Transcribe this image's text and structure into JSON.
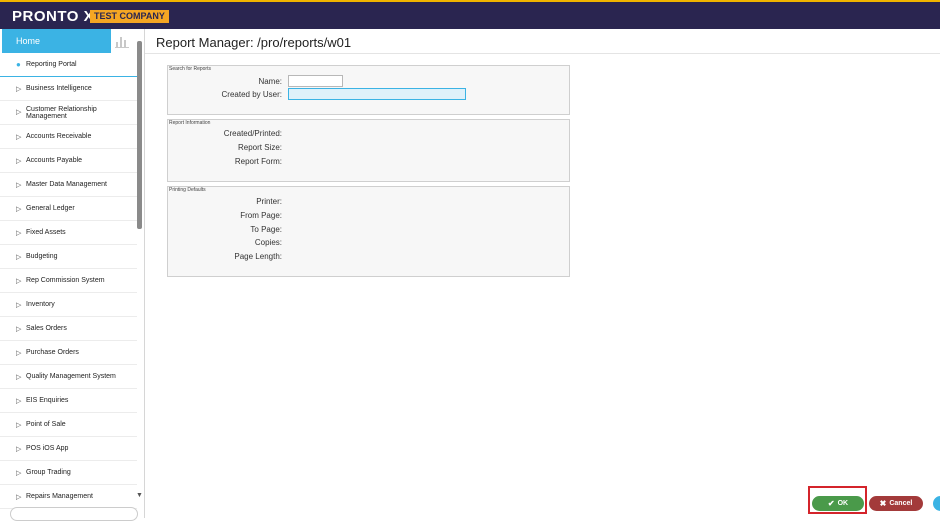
{
  "app": {
    "brand": "PRONTO Xi",
    "company_badge": "TEST COMPANY"
  },
  "sidebar": {
    "home_label": "Home",
    "home_icon": "bar-chart-icon",
    "items": [
      {
        "label": "Reporting Portal",
        "icon": "dot-icon",
        "active": true
      },
      {
        "label": "Business Intelligence",
        "icon": "triangle-right-icon"
      },
      {
        "label": "Customer Relationship Management",
        "icon": "triangle-right-icon"
      },
      {
        "label": "Accounts Receivable",
        "icon": "triangle-right-icon"
      },
      {
        "label": "Accounts Payable",
        "icon": "triangle-right-icon"
      },
      {
        "label": "Master Data Management",
        "icon": "triangle-right-icon"
      },
      {
        "label": "General Ledger",
        "icon": "triangle-right-icon"
      },
      {
        "label": "Fixed Assets",
        "icon": "triangle-right-icon"
      },
      {
        "label": "Budgeting",
        "icon": "triangle-right-icon"
      },
      {
        "label": "Rep Commission System",
        "icon": "triangle-right-icon"
      },
      {
        "label": "Inventory",
        "icon": "triangle-right-icon"
      },
      {
        "label": "Sales Orders",
        "icon": "triangle-right-icon"
      },
      {
        "label": "Purchase Orders",
        "icon": "triangle-right-icon"
      },
      {
        "label": "Quality Management System",
        "icon": "triangle-right-icon"
      },
      {
        "label": "EIS Enquiries",
        "icon": "triangle-right-icon"
      },
      {
        "label": "Point of Sale",
        "icon": "triangle-right-icon"
      },
      {
        "label": "POS iOS App",
        "icon": "triangle-right-icon"
      },
      {
        "label": "Group Trading",
        "icon": "triangle-right-icon"
      },
      {
        "label": "Repairs Management",
        "icon": "triangle-right-icon"
      }
    ]
  },
  "main": {
    "title": "Report Manager: /pro/reports/w01",
    "search": {
      "legend": "Search for Reports",
      "name_label": "Name:",
      "name_value": "",
      "created_by_label": "Created by User:",
      "created_by_value": ""
    },
    "info": {
      "legend": "Report Information",
      "created_label": "Created/Printed:",
      "size_label": "Report Size:",
      "form_label": "Report Form:"
    },
    "printing": {
      "legend": "Printing Defaults",
      "printer_label": "Printer:",
      "from_label": "From Page:",
      "to_label": "To Page:",
      "copies_label": "Copies:",
      "length_label": "Page Length:"
    }
  },
  "footer": {
    "ok_label": "OK",
    "ok_icon": "check-icon",
    "cancel_label": "Cancel",
    "cancel_icon": "x-icon"
  }
}
